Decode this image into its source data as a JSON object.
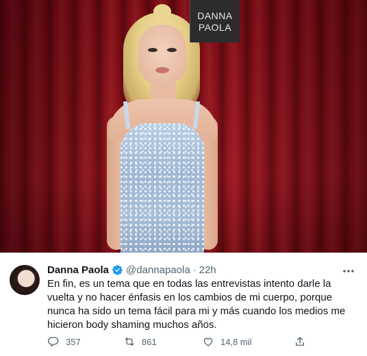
{
  "photo": {
    "sign_line1": "DANNA",
    "sign_line2": "PAOLA"
  },
  "tweet": {
    "author_name": "Danna Paola",
    "verified": true,
    "handle": "@dannapaola",
    "separator": "·",
    "time": "22h",
    "more_icon": "ellipsis-icon",
    "text": "En fin, es un tema que en todas las entrevistas intento darle la vuelta y no hacer énfasis en los cambios de mi cuerpo, porque nunca ha sido un tema fácil para mi y más cuando los medios me hicieron body shaming muchos años.",
    "actions": {
      "reply_count": "357",
      "retweet_count": "861",
      "like_count": "14,8 mil",
      "share_icon": "share-icon"
    }
  },
  "colors": {
    "text_primary": "#0f1419",
    "text_secondary": "#536471",
    "verified_blue": "#1d9bf0"
  }
}
